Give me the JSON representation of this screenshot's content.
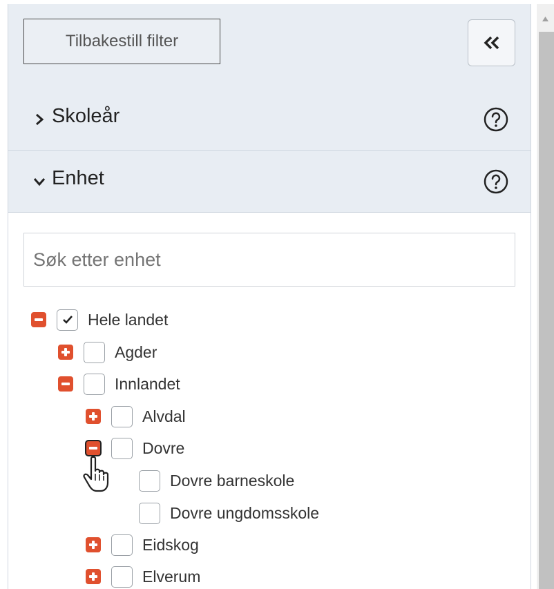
{
  "filter_panel": {
    "reset_label": "Tilbakestill filter",
    "collapse_icon": "double-chevron-left-icon"
  },
  "sections": [
    {
      "title": "Skoleår",
      "expanded": false
    },
    {
      "title": "Enhet",
      "expanded": true
    }
  ],
  "search": {
    "placeholder": "Søk etter enhet",
    "value": ""
  },
  "tree": [
    {
      "label": "Hele landet",
      "checked": true,
      "expanded": true
    },
    {
      "label": "Agder",
      "checked": false,
      "expanded": false
    },
    {
      "label": "Innlandet",
      "checked": false,
      "expanded": true
    },
    {
      "label": "Alvdal",
      "checked": false,
      "expanded": false
    },
    {
      "label": "Dovre",
      "checked": false,
      "expanded": true
    },
    {
      "label": "Dovre barneskole",
      "checked": false
    },
    {
      "label": "Dovre ungdomsskole",
      "checked": false
    },
    {
      "label": "Eidskog",
      "checked": false,
      "expanded": false
    },
    {
      "label": "Elverum",
      "checked": false,
      "expanded": false
    }
  ],
  "colors": {
    "toggle": "#e0502e",
    "section_bg": "#e8edf3"
  }
}
